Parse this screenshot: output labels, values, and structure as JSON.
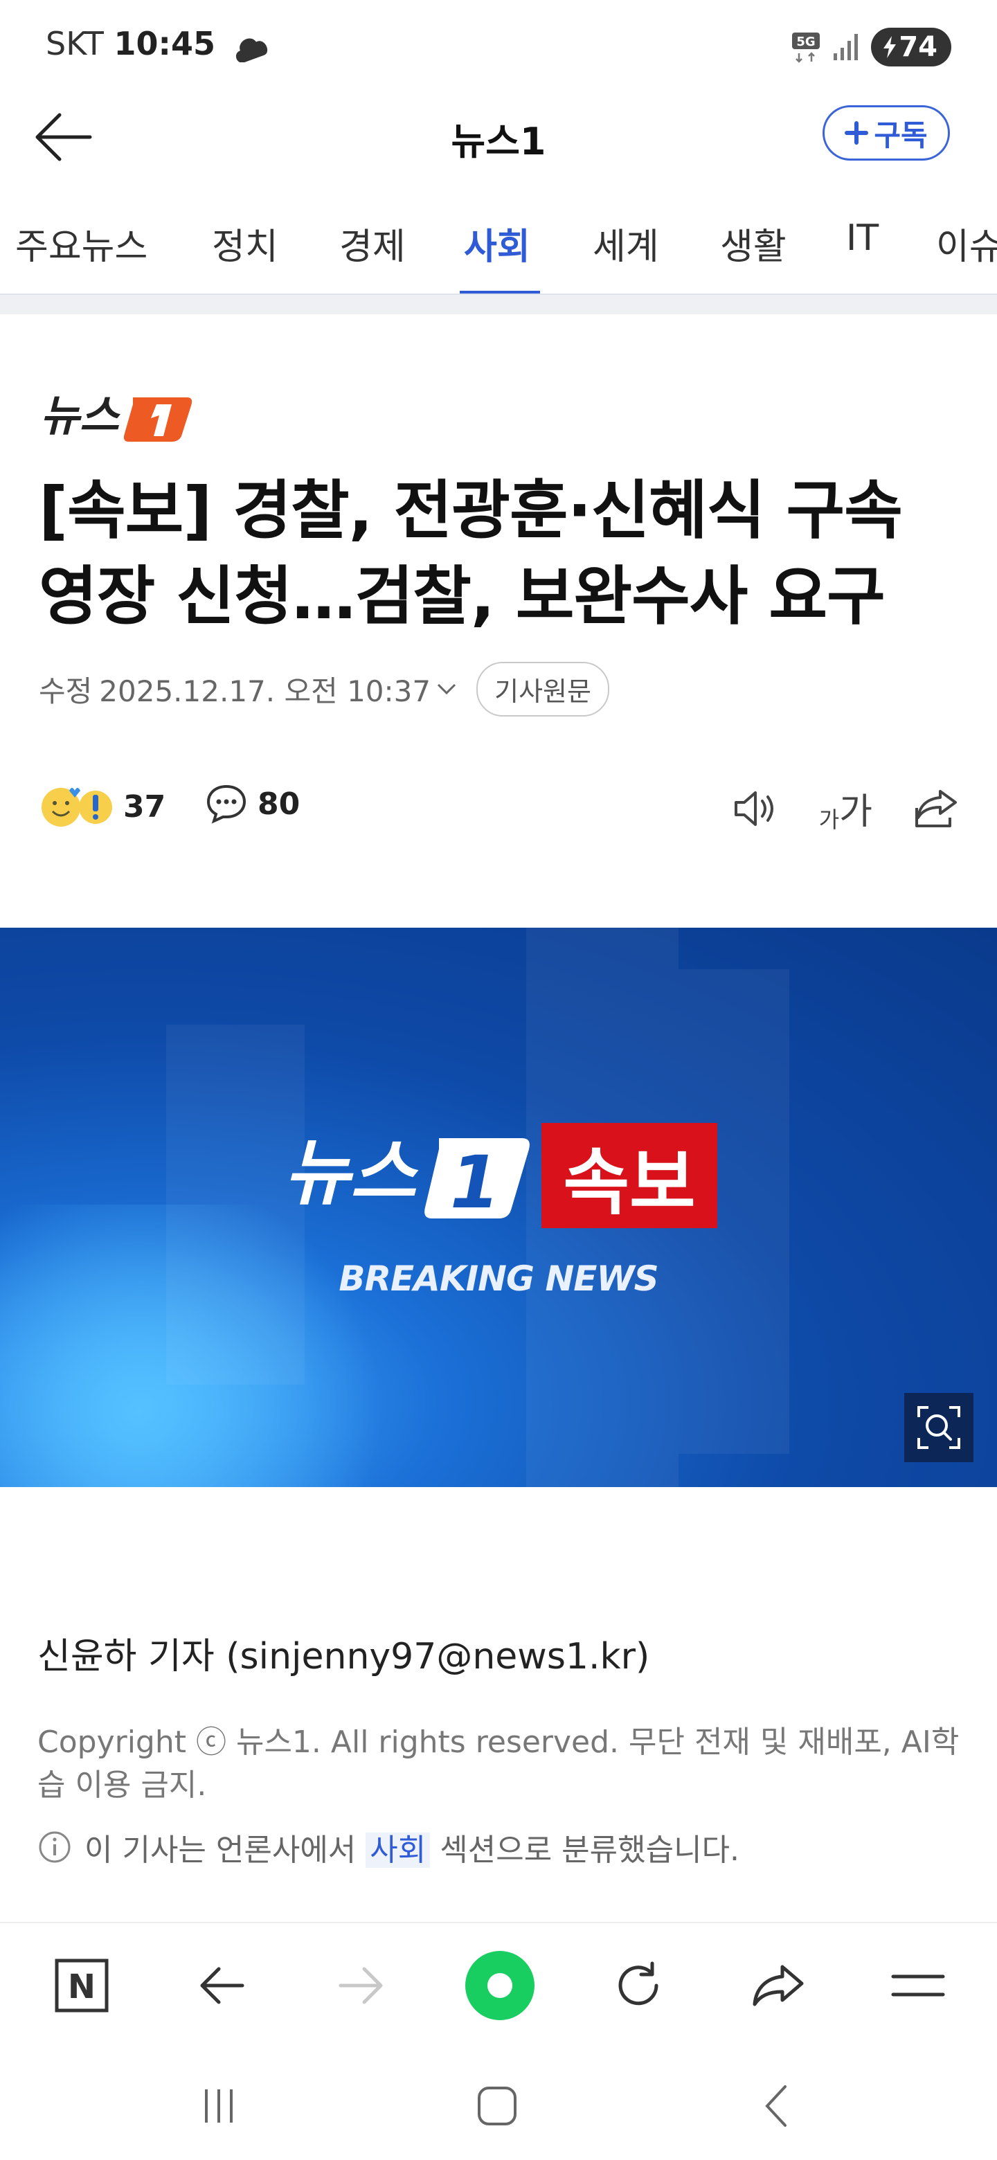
{
  "status": {
    "carrier": "SKT",
    "time": "10:45",
    "network": "5G",
    "battery": "74"
  },
  "header": {
    "title": "뉴스1",
    "subscribe_label": "구독"
  },
  "tabs": [
    "주요뉴스",
    "정치",
    "경제",
    "사회",
    "세계",
    "생활",
    "IT",
    "이슈"
  ],
  "active_tab": "사회",
  "article": {
    "source_logo_text": "뉴스",
    "headline_line1": "[속보] 경찰, 전광훈·신혜식 구속",
    "headline_line2": "영장 신청…검찰, 보완수사 요구",
    "modified_label": "수정",
    "modified_date": "2025.12.17. 오전 10:37",
    "origin_label": "기사원문",
    "reactions_count": "37",
    "comments_count": "80",
    "font_size_label_small": "가",
    "font_size_label_large": "가"
  },
  "hero": {
    "logo_text": "뉴스",
    "logo_number": "1",
    "badge_text": "속보",
    "caption": "BREAKING NEWS"
  },
  "body": {
    "reporter": "신윤하 기자 (sinjenny97@news1.kr)",
    "copyright": "Copyright ⓒ 뉴스1. All rights reserved. 무단 전재 및 재배포, AI학습 이용 금지.",
    "section_prefix": "이 기사는 언론사에서",
    "section_name": "사회",
    "section_suffix": "섹션으로 분류했습니다."
  },
  "browser": {
    "home_label": "N"
  },
  "colors": {
    "accent": "#2f5bd6",
    "brand_orange": "#ee5a24",
    "breaking_red": "#d9111a",
    "green": "#19ce60"
  }
}
